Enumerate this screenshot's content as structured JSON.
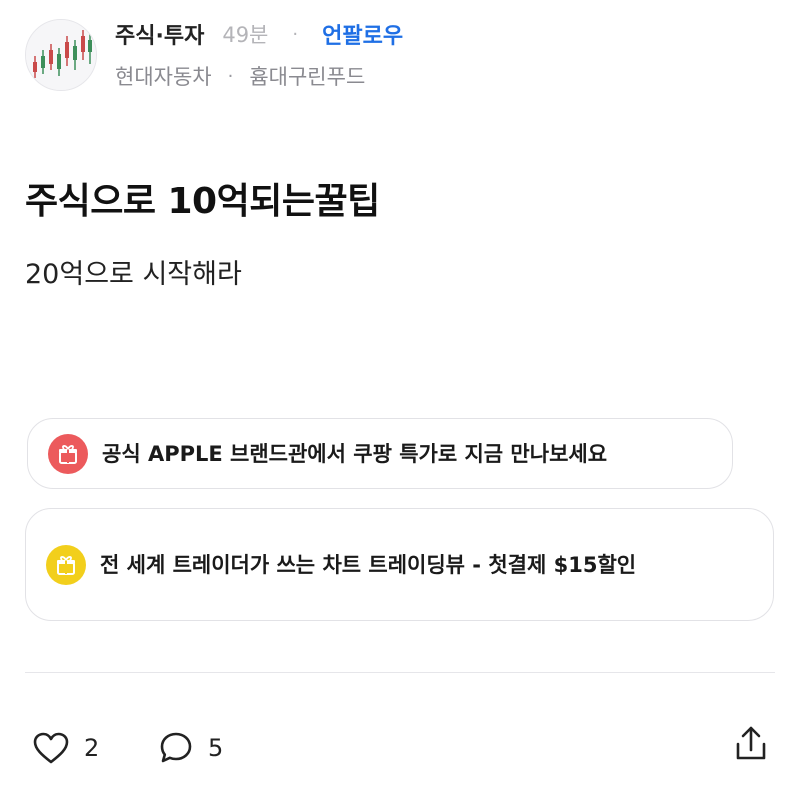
{
  "header": {
    "category": "주식·투자",
    "time_ago": "49분",
    "separator": "·",
    "follow_label": "언팔로우",
    "companies": [
      "현대자동차",
      "흄대구린푸드"
    ]
  },
  "post": {
    "title": "주식으로 10억되는꿀팁",
    "body": "20억으로 시작해라"
  },
  "ads": [
    {
      "text": "공식 APPLE 브랜드관에서 쿠팡 특가로 지금 만나보세요",
      "icon": "gift-icon",
      "color": "#ec5a5c"
    },
    {
      "text": "전 세계 트레이더가 쓰는 차트 트레이딩뷰 - 첫결제 $15할인",
      "icon": "gift-icon",
      "color": "#f2cf1c"
    }
  ],
  "actions": {
    "like_count": "2",
    "comment_count": "5",
    "share_icon": "share-icon"
  },
  "colors": {
    "accent": "#1f6fe5",
    "muted": "#b4b4b8"
  }
}
